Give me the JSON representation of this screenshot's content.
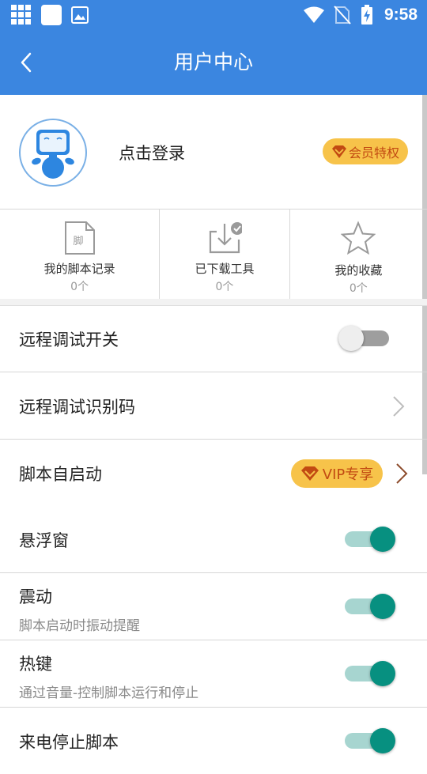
{
  "status_bar": {
    "time": "9:58",
    "icons_left": [
      "grid-app-icon",
      "blank-square-icon",
      "image-icon"
    ],
    "icons_right": [
      "wifi-icon",
      "no-sim-icon",
      "battery-charging-icon"
    ]
  },
  "appbar": {
    "title": "用户中心",
    "back_icon": "chevron-left-icon"
  },
  "profile": {
    "login_text": "点击登录",
    "vip_badge": "会员特权",
    "avatar_icon": "robot-avatar-icon"
  },
  "stats": [
    {
      "label": "我的脚本记录",
      "count": "0个",
      "icon": "script-file-icon",
      "icon_text": "脚"
    },
    {
      "label": "已下载工具",
      "count": "0个",
      "icon": "download-check-icon"
    },
    {
      "label": "我的收藏",
      "count": "0个",
      "icon": "star-icon"
    }
  ],
  "settings": [
    {
      "title": "远程调试开关",
      "control": "toggle",
      "on": false
    },
    {
      "title": "远程调试识别码",
      "control": "chevron"
    },
    {
      "title": "脚本自启动",
      "control": "vip-chevron",
      "badge": "VIP专享"
    },
    {
      "title": "悬浮窗",
      "control": "toggle",
      "on": true
    },
    {
      "title": "震动",
      "subtitle": "脚本启动时振动提醒",
      "control": "toggle",
      "on": true
    },
    {
      "title": "热键",
      "subtitle": "通过音量-控制脚本运行和停止",
      "control": "toggle",
      "on": true
    },
    {
      "title": "来电停止脚本",
      "control": "toggle",
      "on": true
    }
  ],
  "colors": {
    "primary": "#3b86e0",
    "vip_gold": "#f7c34a",
    "vip_text": "#c24a12",
    "toggle_on": "#079080",
    "toggle_track_on": "#a7d5d0"
  }
}
